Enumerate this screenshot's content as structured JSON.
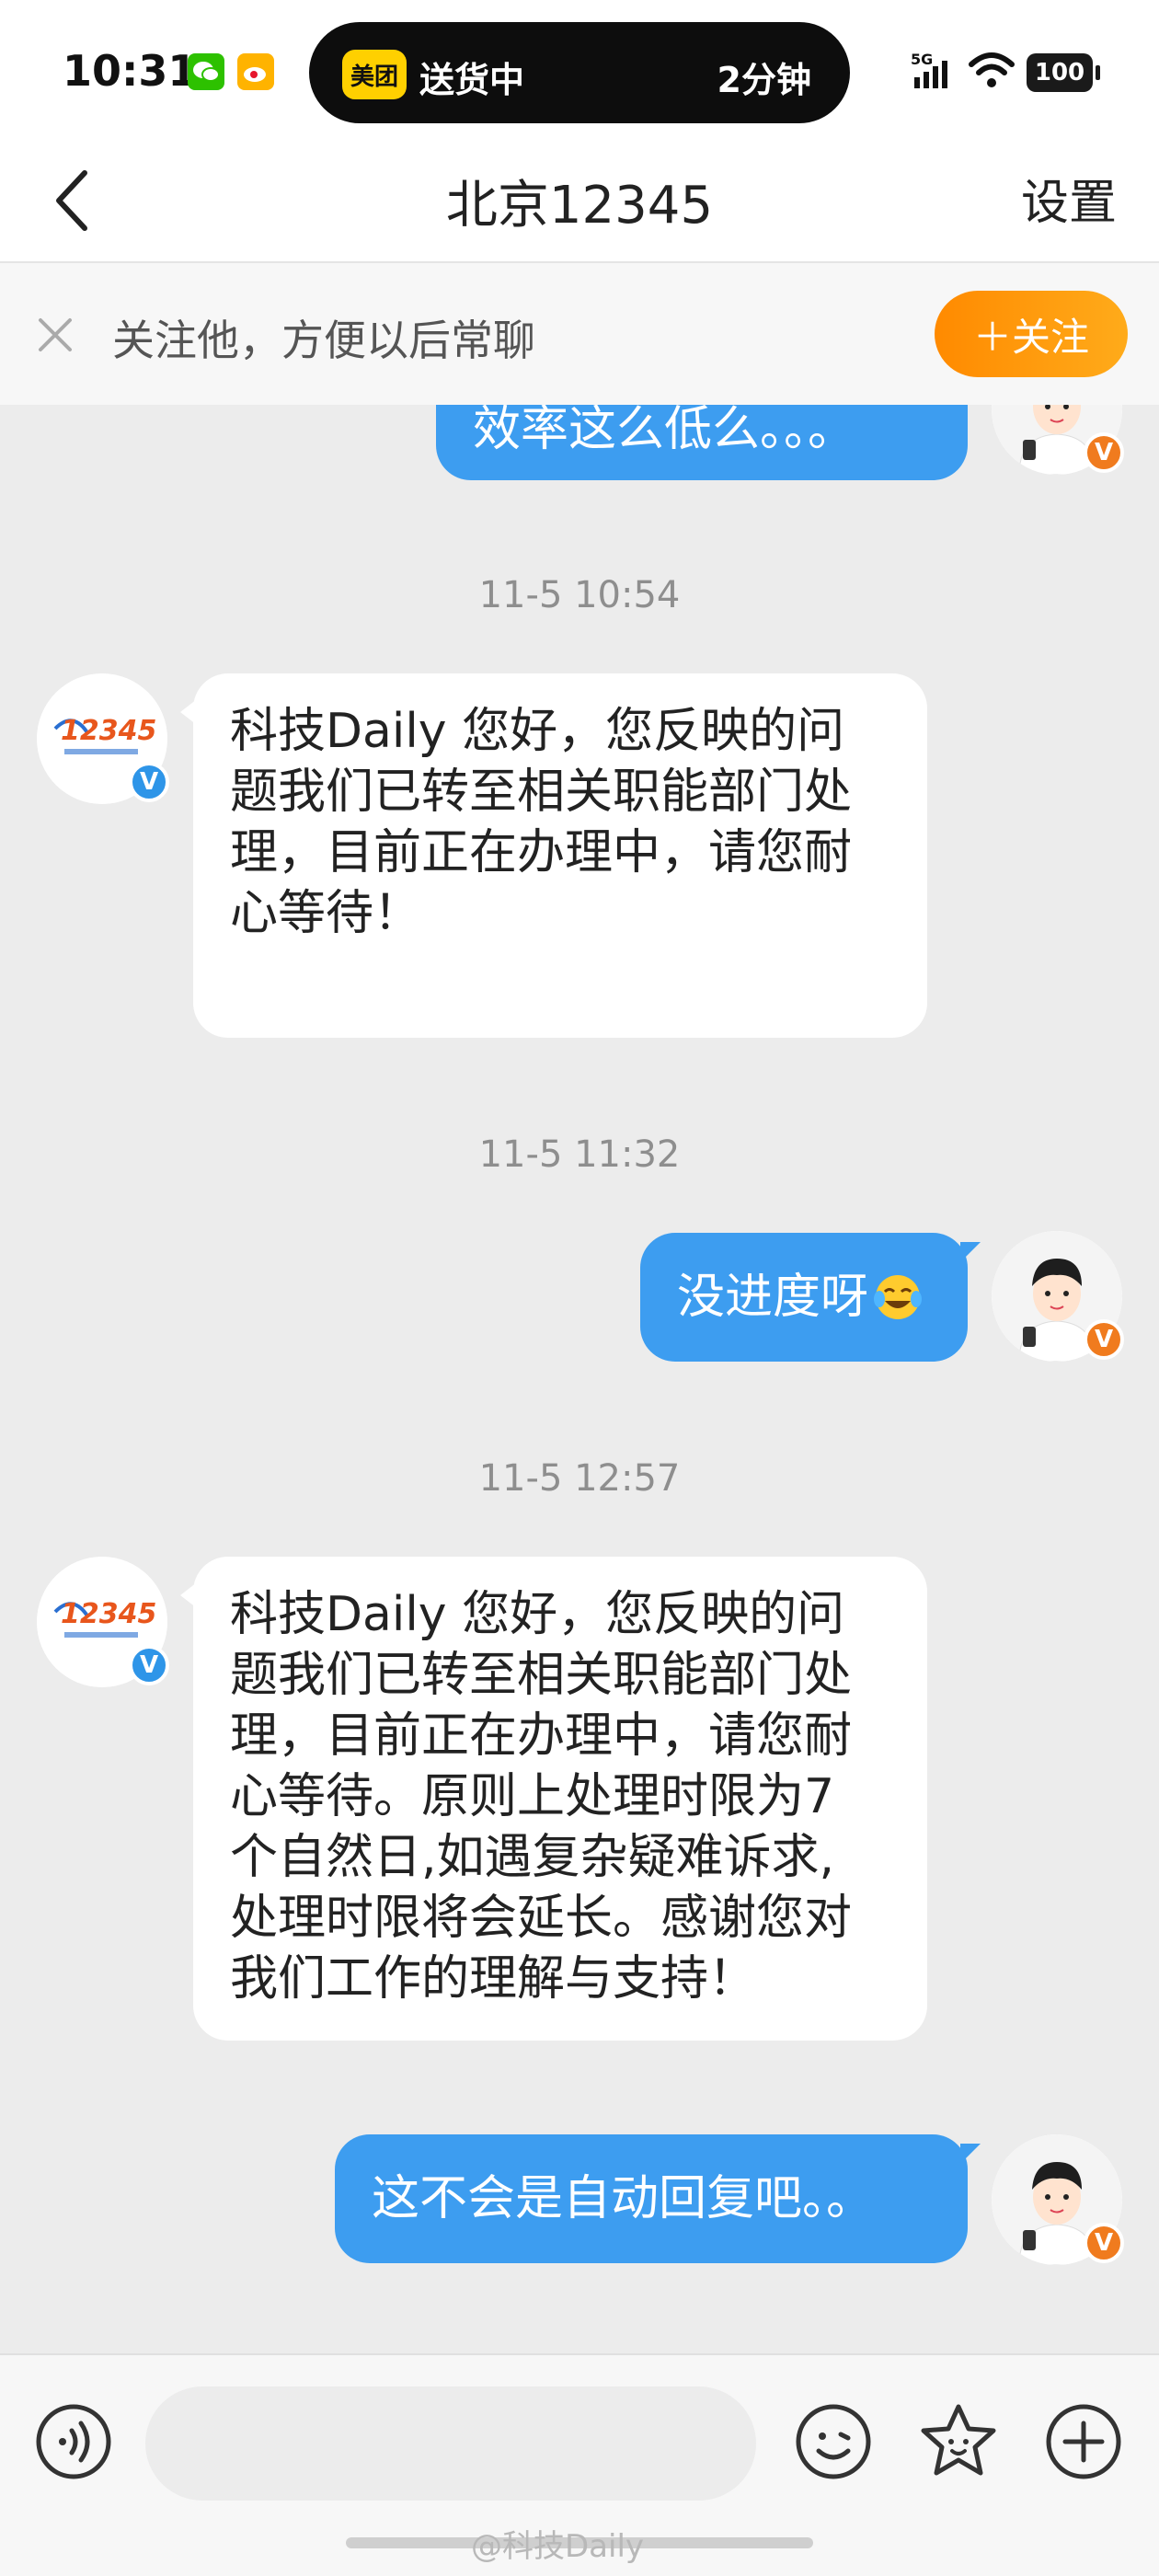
{
  "status_bar": {
    "time": "10:31",
    "pill_app": "美团",
    "pill_text": "送货中",
    "pill_eta": "2分钟",
    "network": "5G",
    "battery": "100"
  },
  "header": {
    "title": "北京12345",
    "settings_label": "设置"
  },
  "follow_banner": {
    "text": "关注他，方便以后常聊",
    "follow_button": "＋关注"
  },
  "messages": [
    {
      "direction": "out",
      "text": "效率这么低么。。。"
    },
    {
      "timestamp": "11-5 10:54"
    },
    {
      "direction": "in",
      "lines": [
        "科技Daily 您好，您反映的问",
        "题我们已转至相关职能部门处",
        "理，目前正在办理中，请您耐",
        "心等待！"
      ]
    },
    {
      "timestamp": "11-5 11:32"
    },
    {
      "direction": "out",
      "text": "没进度呀",
      "emoji": "face-with-tears-of-joy-icon"
    },
    {
      "timestamp": "11-5 12:57"
    },
    {
      "direction": "in",
      "lines": [
        "科技Daily 您好，您反映的问",
        "题我们已转至相关职能部门处",
        "理，目前正在办理中，请您耐",
        "心等待。原则上处理时限为7",
        "个自然日,如遇复杂疑难诉求,",
        "处理时限将会延长。感谢您对",
        "我们工作的理解与支持！"
      ]
    },
    {
      "direction": "out",
      "text": "这不会是自动回复吧。。"
    }
  ],
  "avatars": {
    "contact_logo": "12345",
    "contact_badge": "V",
    "self_badge": "V"
  },
  "watermark": "@科技Daily",
  "colors": {
    "accent_blue": "#3d9df0",
    "follow_orange": "#ff8a00",
    "background": "#ececec"
  }
}
